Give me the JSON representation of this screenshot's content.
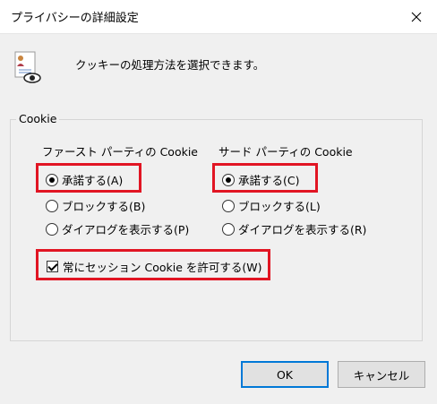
{
  "window": {
    "title": "プライバシーの詳細設定"
  },
  "header": {
    "description": "クッキーの処理方法を選択できます。",
    "icon": "privacy-document-icon"
  },
  "cookie_group": {
    "legend": "Cookie",
    "first_party": {
      "heading": "ファースト パーティの Cookie",
      "options": [
        {
          "label": "承諾する(A)",
          "checked": true
        },
        {
          "label": "ブロックする(B)",
          "checked": false
        },
        {
          "label": "ダイアログを表示する(P)",
          "checked": false
        }
      ]
    },
    "third_party": {
      "heading": "サード パーティの Cookie",
      "options": [
        {
          "label": "承諾する(C)",
          "checked": true
        },
        {
          "label": "ブロックする(L)",
          "checked": false
        },
        {
          "label": "ダイアログを表示する(R)",
          "checked": false
        }
      ]
    },
    "session": {
      "label": "常にセッション Cookie を許可する(W)",
      "checked": true
    }
  },
  "buttons": {
    "ok": "OK",
    "cancel": "キャンセル"
  },
  "colors": {
    "highlight": "#e11523",
    "default_button_border": "#0078d7"
  }
}
